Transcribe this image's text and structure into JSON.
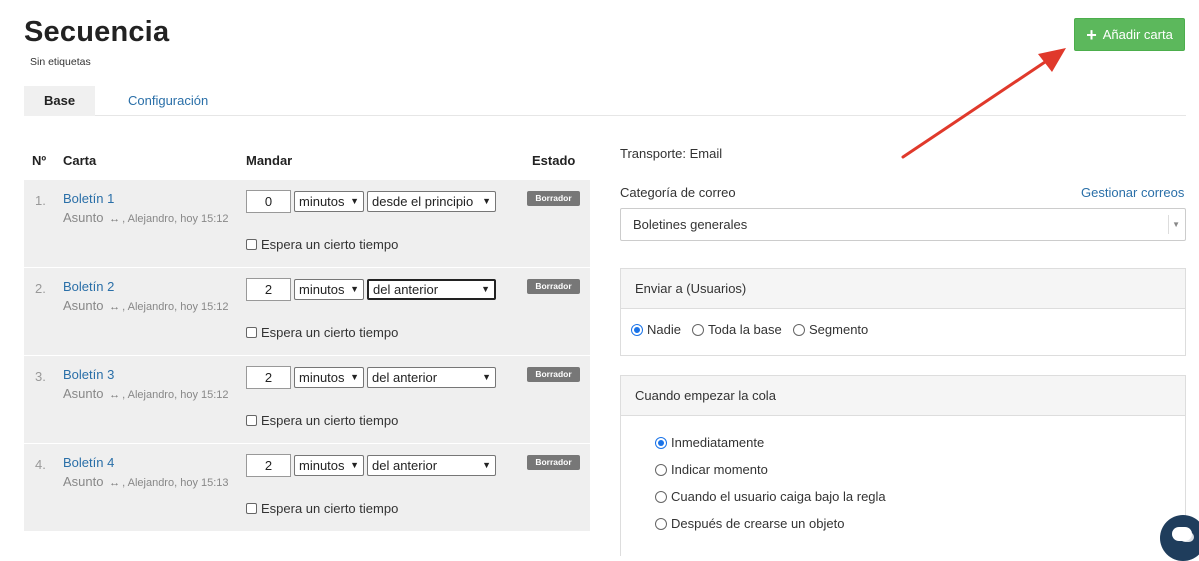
{
  "header": {
    "title": "Secuencia",
    "tags": "Sin etiquetas",
    "add_button_label": "Añadir carta"
  },
  "tabs": [
    {
      "label": "Base",
      "active": true
    },
    {
      "label": "Configuración",
      "active": false
    }
  ],
  "table": {
    "columns": [
      "Nº",
      "Carta",
      "Mandar",
      "Estado"
    ],
    "rows": [
      {
        "num": "1.",
        "name": "Boletín 1",
        "subject": "Asunto",
        "author": ", Alejandro, hoy 15:12",
        "amount": "0",
        "unit": "minutos",
        "reference": "desde el principio",
        "wait_label": "Espera un cierto tiempo",
        "status": "Borrador"
      },
      {
        "num": "2.",
        "name": "Boletín 2",
        "subject": "Asunto",
        "author": ", Alejandro, hoy 15:12",
        "amount": "2",
        "unit": "minutos",
        "reference": "del anterior",
        "wait_label": "Espera un cierto tiempo",
        "status": "Borrador"
      },
      {
        "num": "3.",
        "name": "Boletín 3",
        "subject": "Asunto",
        "author": ", Alejandro, hoy 15:12",
        "amount": "2",
        "unit": "minutos",
        "reference": "del anterior",
        "wait_label": "Espera un cierto tiempo",
        "status": "Borrador"
      },
      {
        "num": "4.",
        "name": "Boletín 4",
        "subject": "Asunto",
        "author": ", Alejandro, hoy 15:13",
        "amount": "2",
        "unit": "minutos",
        "reference": "del anterior",
        "wait_label": "Espera un cierto tiempo",
        "status": "Borrador"
      }
    ]
  },
  "settings": {
    "transport": "Transporte: Email",
    "mail_category_label": "Categoría de correo",
    "manage_mails_link": "Gestionar correos",
    "mail_category_value": "Boletines generales",
    "send_to": {
      "title": "Enviar a (Usuarios)",
      "options": [
        "Nadie",
        "Toda la base",
        "Segmento"
      ],
      "selected": "Nadie"
    },
    "queue_start": {
      "title": "Cuando empezar la cola",
      "options": [
        "Inmediatamente",
        "Indicar momento",
        "Cuando el usuario caiga bajo la regla",
        "Después de crearse un objeto"
      ],
      "selected": "Inmediatamente"
    }
  },
  "colors": {
    "accent_green": "#5cb85c",
    "link_blue": "#2a6fa8",
    "annotation_red": "#e0392b",
    "badge_gray": "#777777"
  },
  "icons": [
    "plus-icon",
    "link-icon",
    "chevron-down-icon",
    "chat-icon"
  ]
}
